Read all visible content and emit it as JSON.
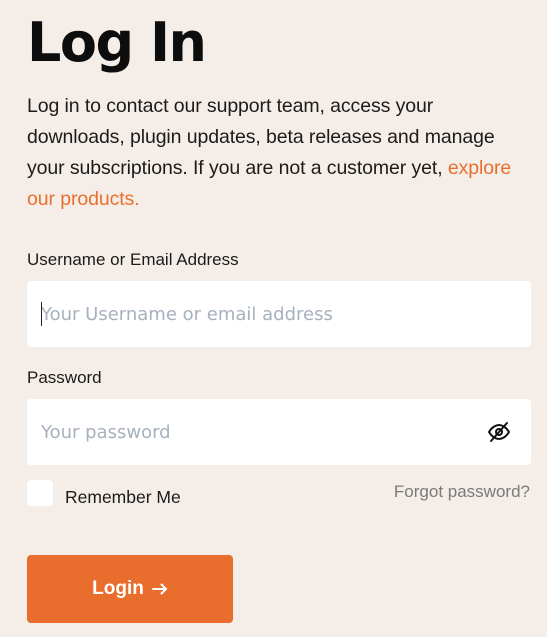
{
  "colors": {
    "background": "#f5eee8",
    "accent": "#e96d2c",
    "link": "#e8702e",
    "placeholder": "#a7b1bd",
    "muted_text": "#7a7a7a"
  },
  "header": {
    "title": "Log In"
  },
  "intro": {
    "text": "Log in to contact our support team, access your downloads, plugin updates, beta releases and manage your subscriptions. If you are not a customer yet, ",
    "link_text": "explore our products."
  },
  "form": {
    "username": {
      "label": "Username or Email Address",
      "placeholder": "Your Username or email address",
      "value": ""
    },
    "password": {
      "label": "Password",
      "placeholder": "Your password",
      "value": "",
      "toggle_icon": "eye-off-icon"
    },
    "remember_me": {
      "label": "Remember Me",
      "checked": false
    },
    "forgot_password": "Forgot password?",
    "submit": {
      "label": "Login",
      "icon": "arrow-right-icon"
    }
  }
}
